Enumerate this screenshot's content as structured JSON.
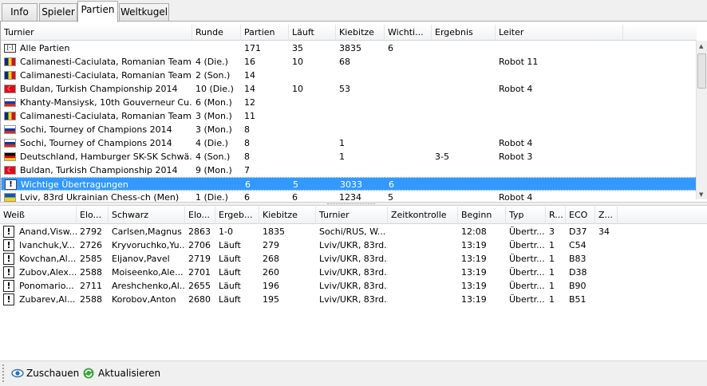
{
  "tabs": [
    "Info",
    "Spieler",
    "Partien",
    "Weltkugel"
  ],
  "tournaments": {
    "columns": [
      "Turnier",
      "Runde",
      "Partien",
      "Läuft",
      "Kiebitze",
      "Wichti...",
      "Ergebnis",
      "Leiter"
    ],
    "rows": [
      {
        "icon": "all",
        "name": "Alle Partien",
        "round": "",
        "games": "171",
        "running": "35",
        "kibitz": "3835",
        "important": "6",
        "result": "",
        "leader": ""
      },
      {
        "icon": "ro",
        "name": "Calimanesti-Caciulata, Romanian Team...",
        "round": "4 (Die.)",
        "games": "16",
        "running": "10",
        "kibitz": "68",
        "important": "",
        "result": "",
        "leader": "Robot 11"
      },
      {
        "icon": "ro",
        "name": "Calimanesti-Caciulata, Romanian Team...",
        "round": "2 (Son.)",
        "games": "14",
        "running": "",
        "kibitz": "",
        "important": "",
        "result": "",
        "leader": ""
      },
      {
        "icon": "tr",
        "name": "Buldan, Turkish Championship 2014",
        "round": "10 (Die.)",
        "games": "14",
        "running": "10",
        "kibitz": "53",
        "important": "",
        "result": "",
        "leader": "Robot 4"
      },
      {
        "icon": "ru",
        "name": "Khanty-Mansiysk, 10th Gouverneur Cu...",
        "round": "6 (Mon.)",
        "games": "12",
        "running": "",
        "kibitz": "",
        "important": "",
        "result": "",
        "leader": ""
      },
      {
        "icon": "ro",
        "name": "Calimanesti-Caciulata, Romanian Team...",
        "round": "3 (Mon.)",
        "games": "11",
        "running": "",
        "kibitz": "",
        "important": "",
        "result": "",
        "leader": ""
      },
      {
        "icon": "ru",
        "name": "Sochi, Tourney of Champions 2014",
        "round": "3 (Mon.)",
        "games": "8",
        "running": "",
        "kibitz": "",
        "important": "",
        "result": "",
        "leader": ""
      },
      {
        "icon": "ru",
        "name": "Sochi, Tourney of Champions 2014",
        "round": "4 (Die.)",
        "games": "8",
        "running": "",
        "kibitz": "1",
        "important": "",
        "result": "",
        "leader": "Robot 4"
      },
      {
        "icon": "de",
        "name": "Deutschland, Hamburger SK-SK Schwä...",
        "round": "4 (Son.)",
        "games": "8",
        "running": "",
        "kibitz": "1",
        "important": "",
        "result": "3-5",
        "leader": "Robot 3"
      },
      {
        "icon": "tr",
        "name": "Buldan, Turkish Championship 2014",
        "round": "9 (Mon.)",
        "games": "7",
        "running": "",
        "kibitz": "",
        "important": "",
        "result": "",
        "leader": ""
      },
      {
        "icon": "bang",
        "name": "Wichtige Übertragungen",
        "round": "",
        "games": "6",
        "running": "5",
        "kibitz": "3033",
        "important": "6",
        "result": "",
        "leader": "",
        "selected": true
      },
      {
        "icon": "ua",
        "name": "Lviv, 83rd Ukrainian Chess-ch (Men)",
        "round": "1 (Die.)",
        "games": "6",
        "running": "6",
        "kibitz": "1234",
        "important": "5",
        "result": "",
        "leader": "Robot 4"
      }
    ]
  },
  "games": {
    "columns": [
      "Weiß",
      "Elo...",
      "Schwarz",
      "Elo...",
      "Ergeb...",
      "Kiebitze",
      "Turnier",
      "Zeitkontrolle",
      "Beginn",
      "Typ",
      "R...",
      "ECO",
      "Z..."
    ],
    "rows": [
      {
        "white": "Anand,Visw...",
        "welo": "2792",
        "black": "Carlsen,Magnus",
        "belo": "2863",
        "result": "1-0",
        "kibitz": "1835",
        "tournament": "Sochi/RUS, W...",
        "tc": "",
        "start": "12:08",
        "type": "Übertr...",
        "round": "3",
        "eco": "D37",
        "z": "34"
      },
      {
        "white": "Ivanchuk,V...",
        "welo": "2726",
        "black": "Kryvoruchko,Yu...",
        "belo": "2706",
        "result": "Läuft",
        "kibitz": "279",
        "tournament": "Lviv/UKR, 83rd...",
        "tc": "",
        "start": "13:19",
        "type": "Übertr...",
        "round": "1",
        "eco": "C54",
        "z": ""
      },
      {
        "white": "Kovchan,Al...",
        "welo": "2585",
        "black": "Eljanov,Pavel",
        "belo": "2719",
        "result": "Läuft",
        "kibitz": "268",
        "tournament": "Lviv/UKR, 83rd...",
        "tc": "",
        "start": "13:19",
        "type": "Übertr...",
        "round": "1",
        "eco": "B83",
        "z": ""
      },
      {
        "white": "Zubov,Alex...",
        "welo": "2588",
        "black": "Moiseenko,Ale...",
        "belo": "2701",
        "result": "Läuft",
        "kibitz": "260",
        "tournament": "Lviv/UKR, 83rd...",
        "tc": "",
        "start": "13:19",
        "type": "Übertr...",
        "round": "1",
        "eco": "D38",
        "z": ""
      },
      {
        "white": "Ponomario...",
        "welo": "2711",
        "black": "Areshchenko,Al...",
        "belo": "2655",
        "result": "Läuft",
        "kibitz": "196",
        "tournament": "Lviv/UKR, 83rd...",
        "tc": "",
        "start": "13:19",
        "type": "Übertr...",
        "round": "1",
        "eco": "B90",
        "z": ""
      },
      {
        "white": "Zubarev,Al...",
        "welo": "2588",
        "black": "Korobov,Anton",
        "belo": "2680",
        "result": "Läuft",
        "kibitz": "195",
        "tournament": "Lviv/UKR, 83rd...",
        "tc": "",
        "start": "13:19",
        "type": "Übertr...",
        "round": "1",
        "eco": "B51",
        "z": ""
      }
    ]
  },
  "toolbar": {
    "watch_label": "Zuschauen",
    "refresh_label": "Aktualisieren"
  },
  "colors": {
    "selection": "#3399ff",
    "refresh_icon": "#3aa63a",
    "watch_icon": "#2a6db5"
  }
}
